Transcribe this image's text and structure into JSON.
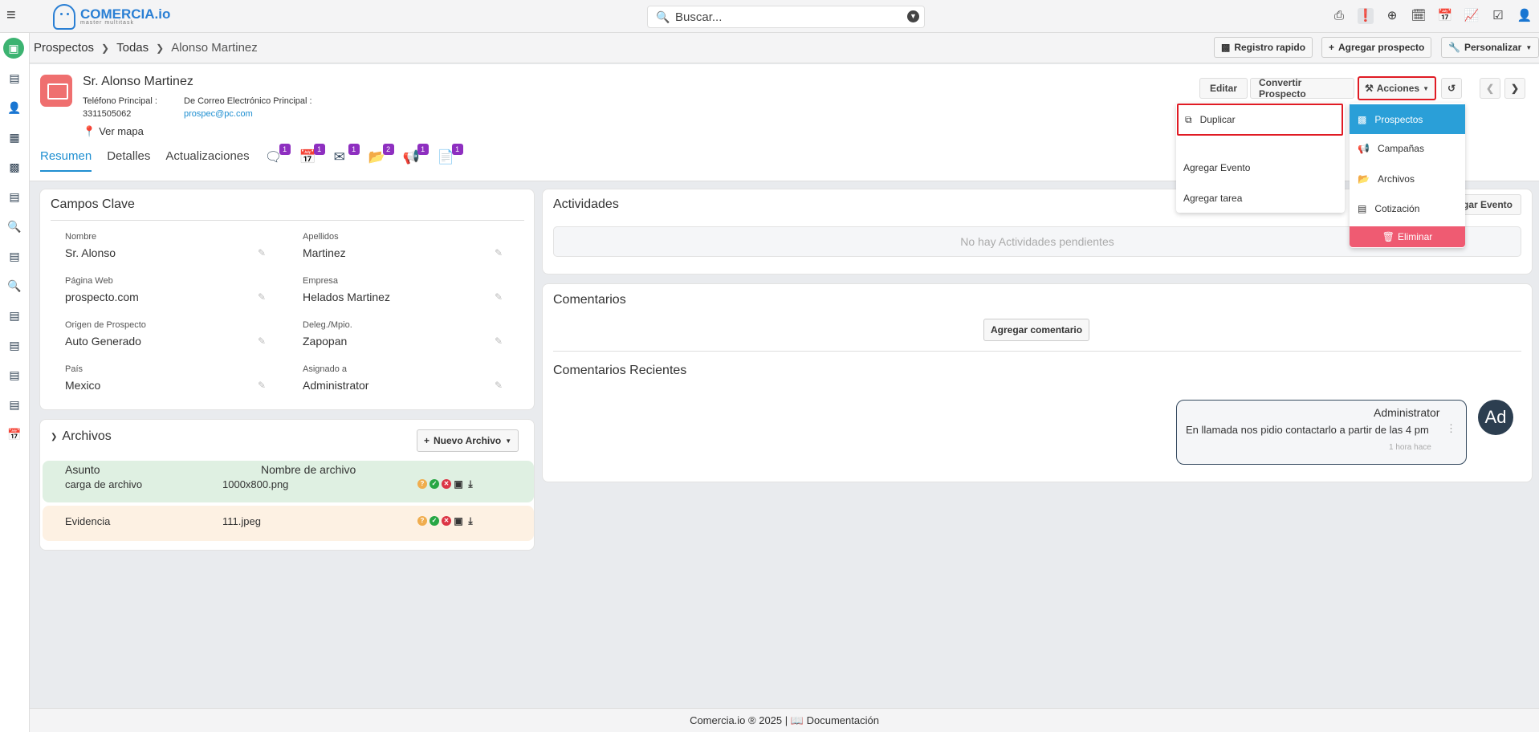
{
  "app": {
    "logo": "COMERCIA.io",
    "logo_sub": "master multitask"
  },
  "search": {
    "placeholder": "Buscar..."
  },
  "top_icons": [
    "fax-icon",
    "alert-icon",
    "plus-circle-icon",
    "calendar-check-icon",
    "calendar-icon",
    "chart-icon",
    "checkbox-icon",
    "user-icon"
  ],
  "breadcrumb": {
    "root": "Prospectos",
    "middle": "Todas",
    "current": "Alonso Martinez"
  },
  "toolbar": {
    "quick": "Registro rapido",
    "add": "Agregar prospecto",
    "customize": "Personalizar"
  },
  "record": {
    "name": "Sr. Alonso Martinez",
    "phone_label": "Teléfono Principal :",
    "phone": "3311505062",
    "email_label": "De Correo Electrónico Principal :",
    "email": "prospec@pc.com",
    "map": "Ver mapa"
  },
  "tabs": {
    "summary": "Resumen",
    "details": "Detalles",
    "updates": "Actualizaciones"
  },
  "tab_badges": [
    "1",
    "1",
    "1",
    "2",
    "1",
    "1"
  ],
  "actions": {
    "edit": "Editar",
    "convert": "Convertir Prospecto",
    "actions": "Acciones"
  },
  "menu_left": {
    "duplicate": "Duplicar",
    "add_event": "Agregar Evento",
    "add_task": "Agregar tarea"
  },
  "menu_right": {
    "prospects": "Prospectos",
    "campaigns": "Campañas",
    "files": "Archivos",
    "quote": "Cotización",
    "delete": "Eliminar"
  },
  "key_fields": {
    "title": "Campos Clave",
    "nombre_lbl": "Nombre",
    "nombre": "Sr. Alonso",
    "apellidos_lbl": "Apellidos",
    "apellidos": "Martinez",
    "web_lbl": "Página Web",
    "web": "prospecto.com",
    "empresa_lbl": "Empresa",
    "empresa": "Helados Martinez",
    "origen_lbl": "Origen de Prospecto",
    "origen": "Auto Generado",
    "deleg_lbl": "Deleg./Mpio.",
    "deleg": "Zapopan",
    "pais_lbl": "País",
    "pais": "Mexico",
    "asignado_lbl": "Asignado a",
    "asignado": "Administrator"
  },
  "files": {
    "title": "Archivos",
    "new": "Nuevo Archivo",
    "col_subject": "Asunto",
    "col_name": "Nombre de archivo",
    "rows": [
      {
        "subject": "carga de archivo",
        "name": "1000x800.png"
      },
      {
        "subject": "Evidencia",
        "name": "111.jpeg"
      }
    ]
  },
  "activities": {
    "title": "Actividades",
    "empty": "No hay Actividades pendientes",
    "add_event": "gar Evento"
  },
  "comments": {
    "title": "Comentarios",
    "add": "Agregar comentario",
    "recent": "Comentarios Recientes",
    "author": "Administrator",
    "text": "En llamada nos pidio contactarlo a partir de las 4 pm",
    "time": "1 hora hace",
    "avatar": "Ad"
  },
  "footer": {
    "brand": "Comercia.io ® 2025",
    "sep": "|",
    "docs": "Documentación"
  }
}
